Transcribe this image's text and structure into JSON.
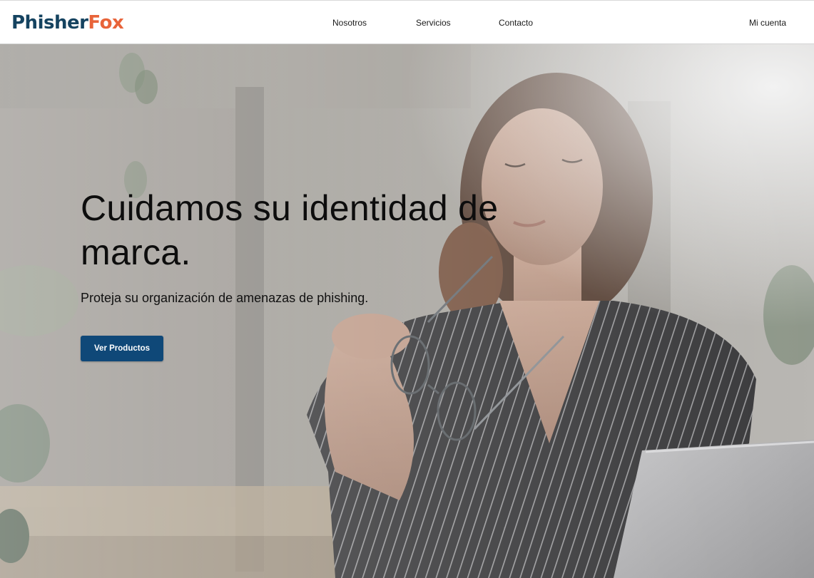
{
  "brand": {
    "name_part_1": "Phisher",
    "name_part_2": "Fox",
    "primary_color": "#154360",
    "accent_color": "#e8643a"
  },
  "nav": {
    "links": [
      {
        "label": "Nosotros"
      },
      {
        "label": "Servicios"
      },
      {
        "label": "Contacto"
      }
    ],
    "account_label": "Mi cuenta"
  },
  "hero": {
    "title": "Cuidamos su identidad de marca.",
    "subtitle": "Proteja su organización de amenazas de phishing.",
    "cta_label": "Ver Productos",
    "cta_color": "#0f4878"
  }
}
